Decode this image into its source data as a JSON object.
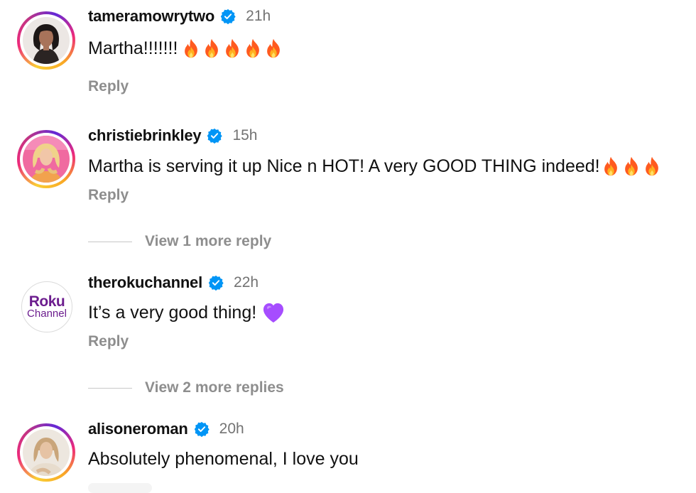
{
  "comments": [
    {
      "username": "tameramowrytwo",
      "time": "21h",
      "text": "Martha!!!!!!!",
      "emoji": [
        "fire-emoji",
        "fire-emoji",
        "fire-emoji",
        "fire-emoji",
        "fire-emoji"
      ],
      "reply_label": "Reply",
      "avatar": "avatar-with-story-ring"
    },
    {
      "username": "christiebrinkley",
      "time": "15h",
      "text": "Martha is serving it up Nice n HOT! A very GOOD THING indeed!",
      "emoji": [
        "fire-emoji",
        "fire-emoji",
        "fire-emoji"
      ],
      "reply_label": "Reply",
      "more_replies": "View 1 more reply",
      "avatar": "avatar-with-story-ring"
    },
    {
      "username": "therokuchannel",
      "time": "22h",
      "text": "It’s a very good thing!",
      "emoji": [
        "purple-heart-emoji"
      ],
      "reply_label": "Reply",
      "more_replies": "View 2 more replies",
      "avatar": "roku-logo-avatar",
      "avatar_logo_word": "Roku",
      "avatar_logo_sub": "Channel"
    },
    {
      "username": "alisoneroman",
      "time": "20h",
      "text": "Absolutely phenomenal, I love you",
      "avatar": "avatar-with-story-ring"
    }
  ],
  "colors": {
    "verified_badge": "#0095f6",
    "meta_gray": "#8e8e8e",
    "timestamp_gray": "#737373",
    "roku_purple": "#6c1d8e",
    "fire_orange": "#ff5a1f",
    "purple_heart": "#a64dff"
  },
  "icons": {
    "verified": "verified-badge-icon"
  }
}
